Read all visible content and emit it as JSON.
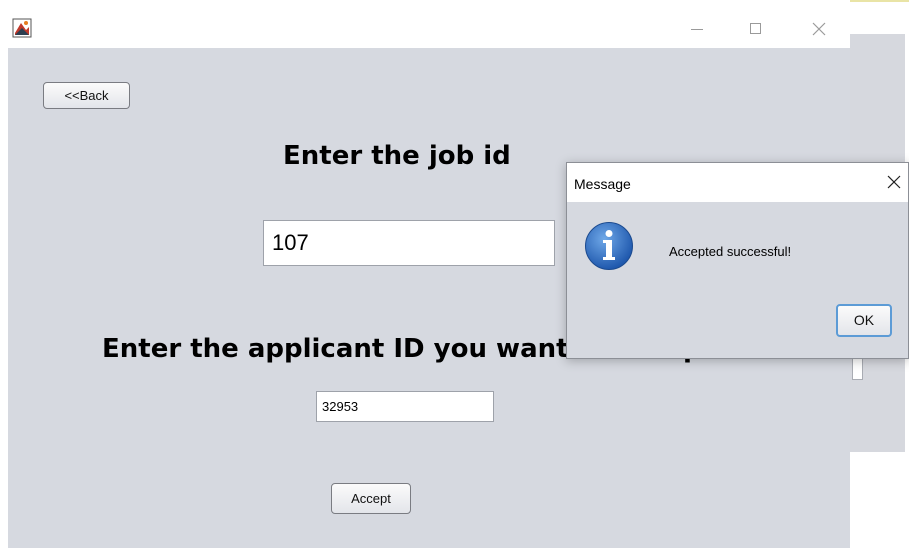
{
  "main_window": {
    "icon": "java-app-icon",
    "controls": {
      "minimize_icon": "minimize-icon",
      "maximize_icon": "maximize-icon",
      "close_icon": "close-icon"
    }
  },
  "content": {
    "back_label": "<<Back",
    "job_heading": "Enter the job id",
    "job_id_value": "107",
    "applicant_heading": "Enter the applicant ID you want to accept",
    "applicant_id_value": "32953",
    "accept_label": "Accept"
  },
  "dialog": {
    "title": "Message",
    "icon": "info-icon",
    "message": "Accepted successful!",
    "ok_label": "OK",
    "close_icon": "close-icon"
  },
  "colors": {
    "panel_background": "#d6d9e0",
    "info_icon_blue": "#2f6fc4",
    "focus_border": "#5c9bd6"
  }
}
